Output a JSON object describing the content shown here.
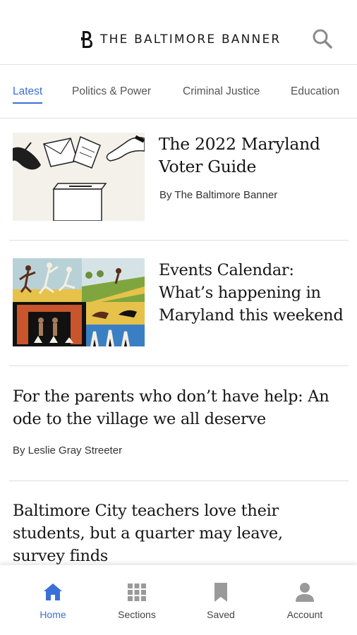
{
  "header": {
    "brand_name": "THE BALTIMORE BANNER",
    "logo_icon": "banner-b-logo",
    "search_icon": "search-icon"
  },
  "tabs": [
    {
      "label": "Latest",
      "active": true
    },
    {
      "label": "Politics & Power",
      "active": false
    },
    {
      "label": "Criminal Justice",
      "active": false
    },
    {
      "label": "Education",
      "active": false
    }
  ],
  "articles": [
    {
      "headline_lines": [
        "The 2022 Maryland",
        "Voter Guide"
      ],
      "byline": "By The Baltimore Banner",
      "image": "voting-ballot-box-illustration"
    },
    {
      "headline_lines": [
        "Events Calendar:",
        "What’s happening in",
        "Maryland this weekend"
      ],
      "image": "events-collage-illustration"
    },
    {
      "headline_lines": [
        "For the parents who don’t have help: An",
        "ode to the village we all deserve"
      ],
      "byline": "By Leslie Gray Streeter"
    },
    {
      "headline_lines": [
        "Baltimore City teachers love their",
        "students, but a quarter may leave,",
        "survey finds"
      ]
    }
  ],
  "bottom_nav": [
    {
      "label": "Home",
      "icon": "home-icon",
      "active": true
    },
    {
      "label": "Sections",
      "icon": "grid-icon",
      "active": false
    },
    {
      "label": "Saved",
      "icon": "bookmark-icon",
      "active": false
    },
    {
      "label": "Account",
      "icon": "person-icon",
      "active": false
    }
  ],
  "colors": {
    "accent": "#3b6fd8",
    "text": "#151515",
    "inactive_icon": "#9a9a9a",
    "divider": "#dedede"
  }
}
